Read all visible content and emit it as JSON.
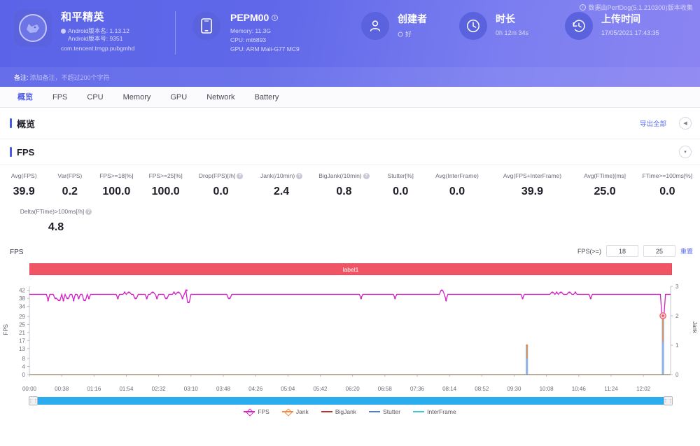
{
  "header": {
    "datasource_note": "数据由PerfDog(5.1.210300)版本收集",
    "app": {
      "name": "和平精英",
      "version_name": "Android版本名: 1.13.12",
      "version_code": "Android版本号: 9351",
      "package": "com.tencent.tmgp.pubgmhd"
    },
    "device": {
      "model": "PEPM00",
      "memory": "Memory: 11.3G",
      "cpu": "CPU: mt6893",
      "gpu": "GPU: ARM Mali-G77 MC9"
    },
    "creator": {
      "label": "创建者",
      "value": "好"
    },
    "duration": {
      "label": "时长",
      "value": "0h 12m 34s"
    },
    "upload": {
      "label": "上传时间",
      "value": "17/05/2021 17:43:35"
    },
    "remark": {
      "key": "备注:",
      "value": "添加备注，不超过200个字符"
    }
  },
  "tabs": [
    {
      "label": "概览",
      "active": true
    },
    {
      "label": "FPS",
      "active": false
    },
    {
      "label": "CPU",
      "active": false
    },
    {
      "label": "Memory",
      "active": false
    },
    {
      "label": "GPU",
      "active": false
    },
    {
      "label": "Network",
      "active": false
    },
    {
      "label": "Battery",
      "active": false
    }
  ],
  "overview": {
    "title": "概览",
    "export_label": "导出全部",
    "collapse_icon": "◀"
  },
  "fps_section": {
    "title": "FPS",
    "collapse_icon": "▾",
    "metrics_row1": [
      {
        "label": "Avg(FPS)",
        "value": "39.9",
        "help": false
      },
      {
        "label": "Var(FPS)",
        "value": "0.2",
        "help": false
      },
      {
        "label": "FPS>=18[%]",
        "value": "100.0",
        "help": false
      },
      {
        "label": "FPS>=25[%]",
        "value": "100.0",
        "help": false
      },
      {
        "label": "Drop(FPS)[/h]",
        "value": "0.0",
        "help": true
      },
      {
        "label": "Jank(/10min)",
        "value": "2.4",
        "help": true
      },
      {
        "label": "BigJank(/10min)",
        "value": "0.8",
        "help": true
      },
      {
        "label": "Stutter[%]",
        "value": "0.0",
        "help": false
      },
      {
        "label": "Avg(InterFrame)",
        "value": "0.0",
        "help": false
      },
      {
        "label": "Avg(FPS+InterFrame)",
        "value": "39.9",
        "help": false
      },
      {
        "label": "Avg(FTime)[ms]",
        "value": "25.0",
        "help": false
      },
      {
        "label": "FTime>=100ms[%]",
        "value": "0.0",
        "help": false
      }
    ],
    "metrics_row2": [
      {
        "label": "Delta(FTime)>100ms[/h]",
        "value": "4.8",
        "help": true
      }
    ],
    "chart_title": "FPS",
    "controls": {
      "fps_threshold_label": "FPS(>=)",
      "threshold_low": "18",
      "threshold_high": "25",
      "reset_label": "重置"
    },
    "label_bar": "label1"
  },
  "chart_data": {
    "type": "line",
    "title": "FPS",
    "xlabel": "",
    "ylabel": "FPS",
    "y2label": "Jank",
    "ylim": [
      0,
      44
    ],
    "y2lim": [
      0,
      3
    ],
    "yticks": [
      0,
      4,
      8,
      13,
      17,
      21,
      25,
      29,
      34,
      38,
      42
    ],
    "y2ticks": [
      0,
      1,
      2,
      3
    ],
    "grid": false,
    "legend_position": "bottom",
    "xticks": [
      "00:00",
      "00:38",
      "01:16",
      "01:54",
      "02:32",
      "03:10",
      "03:48",
      "04:26",
      "05:04",
      "05:42",
      "06:20",
      "06:58",
      "07:36",
      "08:14",
      "08:52",
      "09:30",
      "10:08",
      "10:46",
      "11:24",
      "12:02"
    ],
    "annotations": [
      {
        "text": "label1",
        "type": "range-band",
        "color": "#ef5565",
        "from": "00:00",
        "to": "12:34"
      },
      {
        "text": "highlighted jank point",
        "type": "point",
        "x": "12:25",
        "y": 2,
        "color": "#ef5565"
      }
    ],
    "series": [
      {
        "name": "FPS",
        "color": "#d424c6",
        "axis": "left",
        "avg": 39.9,
        "baseline": 40,
        "dips": [
          {
            "t": "00:22",
            "v": 37
          },
          {
            "t": "00:31",
            "v": 38
          },
          {
            "t": "00:35",
            "v": 37
          },
          {
            "t": "00:40",
            "v": 37
          },
          {
            "t": "00:45",
            "v": 38
          },
          {
            "t": "00:52",
            "v": 37
          },
          {
            "t": "00:58",
            "v": 38
          },
          {
            "t": "01:05",
            "v": 37
          },
          {
            "t": "01:10",
            "v": 38
          },
          {
            "t": "01:44",
            "v": 38
          },
          {
            "t": "01:52",
            "v": 41
          },
          {
            "t": "01:57",
            "v": 41
          },
          {
            "t": "02:05",
            "v": 38
          },
          {
            "t": "02:18",
            "v": 38
          },
          {
            "t": "02:25",
            "v": 41
          },
          {
            "t": "02:30",
            "v": 38
          },
          {
            "t": "02:41",
            "v": 38
          },
          {
            "t": "02:50",
            "v": 41
          },
          {
            "t": "02:55",
            "v": 41
          },
          {
            "t": "03:00",
            "v": 38
          },
          {
            "t": "03:05",
            "v": 42
          },
          {
            "t": "03:07",
            "v": 36
          },
          {
            "t": "03:55",
            "v": 38
          },
          {
            "t": "06:30",
            "v": 38
          },
          {
            "t": "07:10",
            "v": 38
          },
          {
            "t": "08:05",
            "v": 42
          },
          {
            "t": "08:10",
            "v": 37
          },
          {
            "t": "09:40",
            "v": 38
          },
          {
            "t": "10:15",
            "v": 41
          },
          {
            "t": "10:20",
            "v": 41
          },
          {
            "t": "10:25",
            "v": 41
          },
          {
            "t": "10:35",
            "v": 41
          },
          {
            "t": "10:42",
            "v": 41
          },
          {
            "t": "11:00",
            "v": 38
          },
          {
            "t": "12:25",
            "v": 28
          }
        ]
      },
      {
        "name": "Jank",
        "color": "#f08a3c",
        "axis": "right",
        "spikes": [
          {
            "t": "09:45",
            "v": 1
          },
          {
            "t": "12:25",
            "v": 2
          }
        ]
      },
      {
        "name": "BigJank",
        "color": "#b5352e",
        "axis": "right",
        "spikes": []
      },
      {
        "name": "Stutter",
        "color": "#4a7fd4",
        "axis": "right",
        "spikes": [
          {
            "t": "09:45",
            "v": 1
          },
          {
            "t": "12:25",
            "v": 2
          }
        ]
      },
      {
        "name": "InterFrame",
        "color": "#3ec9d6",
        "axis": "left",
        "spikes": []
      }
    ],
    "legend": [
      {
        "name": "FPS",
        "color": "#d424c6",
        "marker": true
      },
      {
        "name": "Jank",
        "color": "#f08a3c",
        "marker": true
      },
      {
        "name": "BigJank",
        "color": "#b5352e",
        "marker": false
      },
      {
        "name": "Stutter",
        "color": "#4a7fd4",
        "marker": false
      },
      {
        "name": "InterFrame",
        "color": "#3ec9d6",
        "marker": false
      }
    ]
  },
  "scrollbar": {
    "left_handle": "⋮⋮",
    "right_handle": "⋮⋮"
  }
}
